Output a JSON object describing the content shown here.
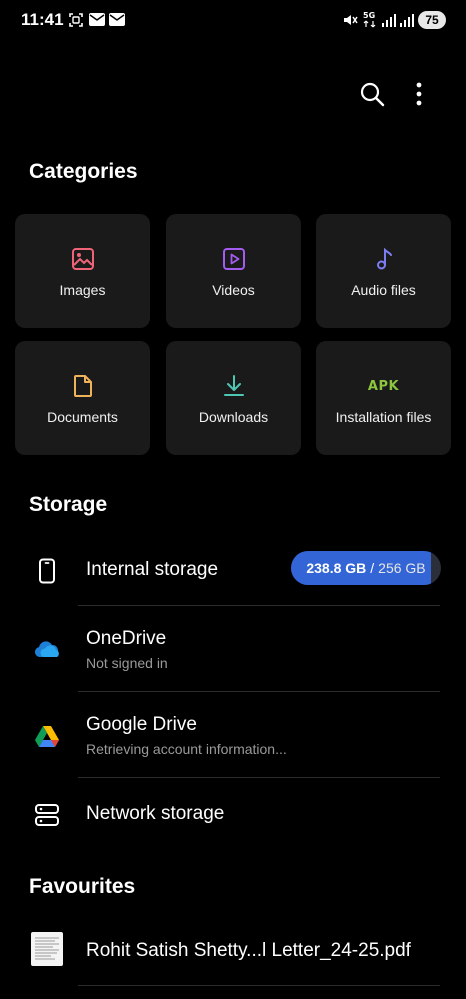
{
  "status_bar": {
    "time": "11:41",
    "battery": "75",
    "icons": [
      "screenshot-icon",
      "mail-icon",
      "mail-icon",
      "mute-icon",
      "5g-icon",
      "signal-icon",
      "signal-icon"
    ]
  },
  "top_bar": {
    "icons": [
      "search-icon",
      "more-options-icon"
    ]
  },
  "categories": {
    "title": "Categories",
    "items": [
      {
        "label": "Images",
        "icon": "image-icon",
        "color": "#f06478"
      },
      {
        "label": "Videos",
        "icon": "video-icon",
        "color": "#a35bf0"
      },
      {
        "label": "Audio files",
        "icon": "music-note-icon",
        "color": "#7b7ef2"
      },
      {
        "label": "Documents",
        "icon": "document-icon",
        "color": "#f0b25a"
      },
      {
        "label": "Downloads",
        "icon": "download-icon",
        "color": "#4fc7b5"
      },
      {
        "label": "Installation files",
        "icon": "apk-icon",
        "icon_text": "APK",
        "color": "#8cc63f"
      }
    ]
  },
  "storage": {
    "title": "Storage",
    "internal": {
      "label": "Internal storage",
      "used": "238.8 GB",
      "separator": "/",
      "total": "256 GB",
      "used_fraction": 0.933,
      "bar_color": "#3465d6"
    },
    "onedrive": {
      "label": "OneDrive",
      "sublabel": "Not signed in"
    },
    "google_drive": {
      "label": "Google Drive",
      "sublabel": "Retrieving account information..."
    },
    "network": {
      "label": "Network storage"
    }
  },
  "favourites": {
    "title": "Favourites",
    "items": [
      {
        "label": "Rohit Satish Shetty...l Letter_24-25.pdf",
        "icon": "pdf-thumbnail-icon"
      }
    ]
  }
}
